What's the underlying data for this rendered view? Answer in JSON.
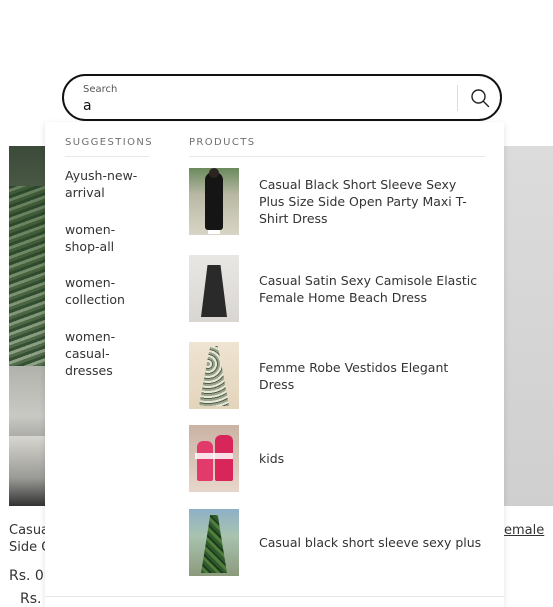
{
  "background": {
    "left_text_line1": "Casual",
    "left_text_line2": "Side O",
    "left_price1": "Rs. 0",
    "left_price2": "Rs.",
    "right_link": "emale"
  },
  "search": {
    "label": "Search",
    "value": "a"
  },
  "dropdown": {
    "suggestions_heading": "SUGGESTIONS",
    "products_heading": "PRODUCTS",
    "suggestions": [
      "Ayush-new-arrival",
      "women-shop-all",
      "women-collection",
      "women-casual-dresses"
    ],
    "products": [
      "Casual Black Short Sleeve Sexy Plus Size Side Open Party Maxi T-Shirt Dress",
      "Casual Satin Sexy Camisole Elastic Female Home Beach Dress",
      "Femme Robe Vestidos Elegant Dress",
      "kids",
      "Casual black short sleeve sexy plus"
    ]
  },
  "icons": {
    "search_button": "search-icon"
  }
}
